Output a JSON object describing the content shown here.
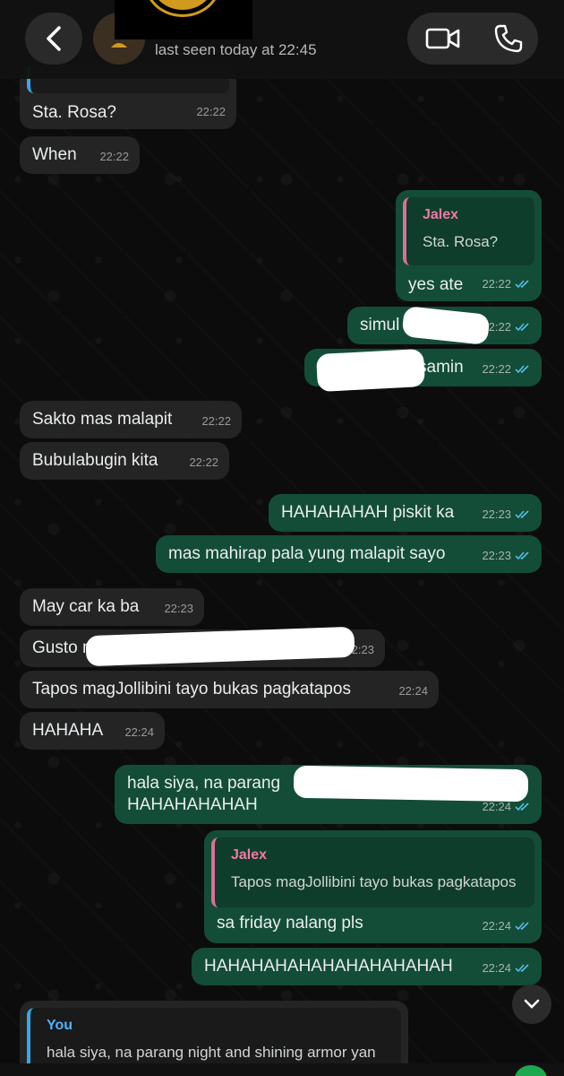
{
  "header": {
    "last_seen": "last seen today at 22:45",
    "icons": [
      "back-arrow-icon",
      "avatar-placeholder-icon",
      "video-call-icon",
      "phone-call-icon"
    ]
  },
  "colors": {
    "incoming_bubble": "#242424",
    "outgoing_bubble": "#134d37",
    "quote_name_pink": "#f07aa6",
    "quote_name_blue": "#4fb3ff",
    "read_ticks": "#53bdeb"
  },
  "messages": [
    {
      "text": "Sta. Rosa?",
      "time": "22:22"
    },
    {
      "text": "When",
      "time": "22:22"
    },
    {
      "quote_name": "Jalex",
      "quote_text": "Sta. Rosa?",
      "text": "yes ate",
      "time": "22:22"
    },
    {
      "text": "simul",
      "time": "22:22"
    },
    {
      "text": "samin",
      "time": "22:22"
    },
    {
      "text": "Sakto mas malapit",
      "time": "22:22"
    },
    {
      "text": "Bubulabugin kita",
      "time": "22:22"
    },
    {
      "text": "HAHAHAHAH piskit ka",
      "time": "22:23"
    },
    {
      "text": "mas mahirap pala yung malapit sayo",
      "time": "22:23"
    },
    {
      "text": "May car ka ba",
      "time": "22:23"
    },
    {
      "text": "Gusto m",
      "time": "22:23"
    },
    {
      "text": "Tapos magJollibini tayo bukas pagkatapos",
      "time": "22:24"
    },
    {
      "text": "HAHAHA",
      "time": "22:24"
    },
    {
      "text": "hala siya, na parang",
      "text2": "HAHAHAHAHAH",
      "time": "22:24"
    },
    {
      "quote_name": "Jalex",
      "quote_text": "Tapos magJollibini tayo bukas pagkatapos",
      "text": "sa friday nalang pls",
      "time": "22:24"
    },
    {
      "text": "HAHAHAHAHAHAHAHAHAHAH",
      "time": "22:24"
    },
    {
      "quote_name": "You",
      "quote_text": "hala siya, na parang night and shining armor yan"
    }
  ]
}
